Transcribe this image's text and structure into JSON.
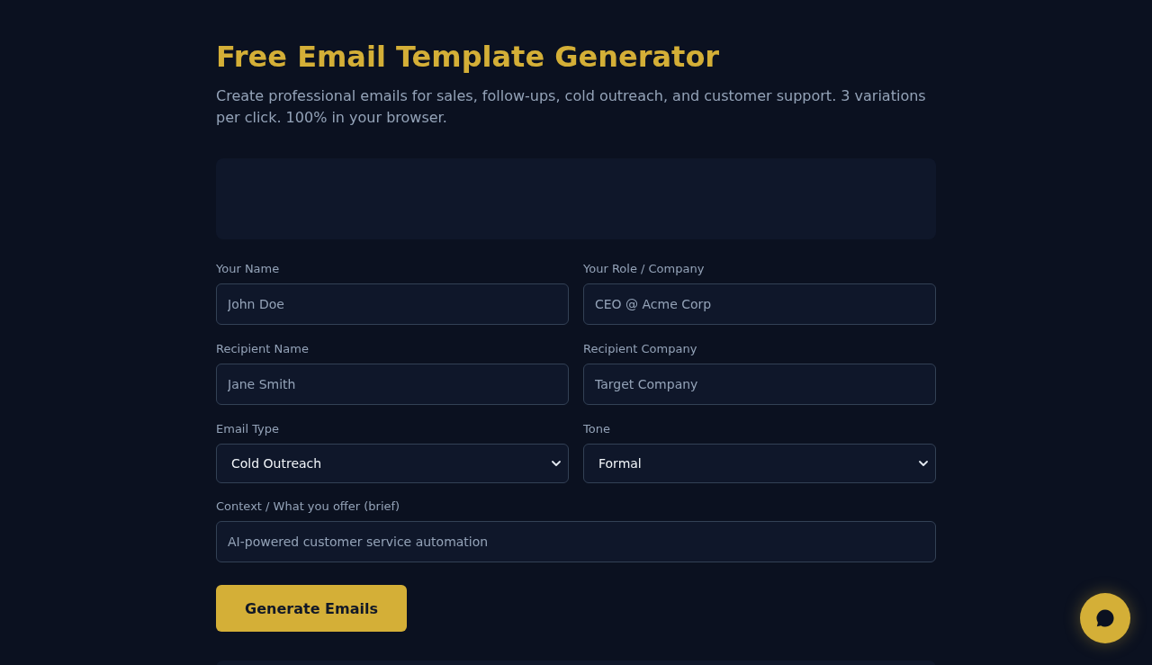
{
  "header": {
    "title": "Free Email Template Generator",
    "subtitle": "Create professional emails for sales, follow-ups, cold outreach, and customer support. 3 variations per click. 100% in your browser."
  },
  "form": {
    "fields": [
      {
        "kind": "text",
        "label": "Your Name",
        "placeholder": "John Doe"
      },
      {
        "kind": "text",
        "label": "Your Role / Company",
        "placeholder": "CEO @ Acme Corp"
      },
      {
        "kind": "text",
        "label": "Recipient Name",
        "placeholder": "Jane Smith"
      },
      {
        "kind": "text",
        "label": "Recipient Company",
        "placeholder": "Target Company"
      },
      {
        "kind": "select",
        "label": "Email Type",
        "value": "Cold Outreach"
      },
      {
        "kind": "select",
        "label": "Tone",
        "value": "Formal"
      }
    ],
    "context": {
      "label": "Context / What you offer (brief)",
      "placeholder": "AI-powered customer service automation"
    },
    "submit_button": "Generate Emails"
  }
}
